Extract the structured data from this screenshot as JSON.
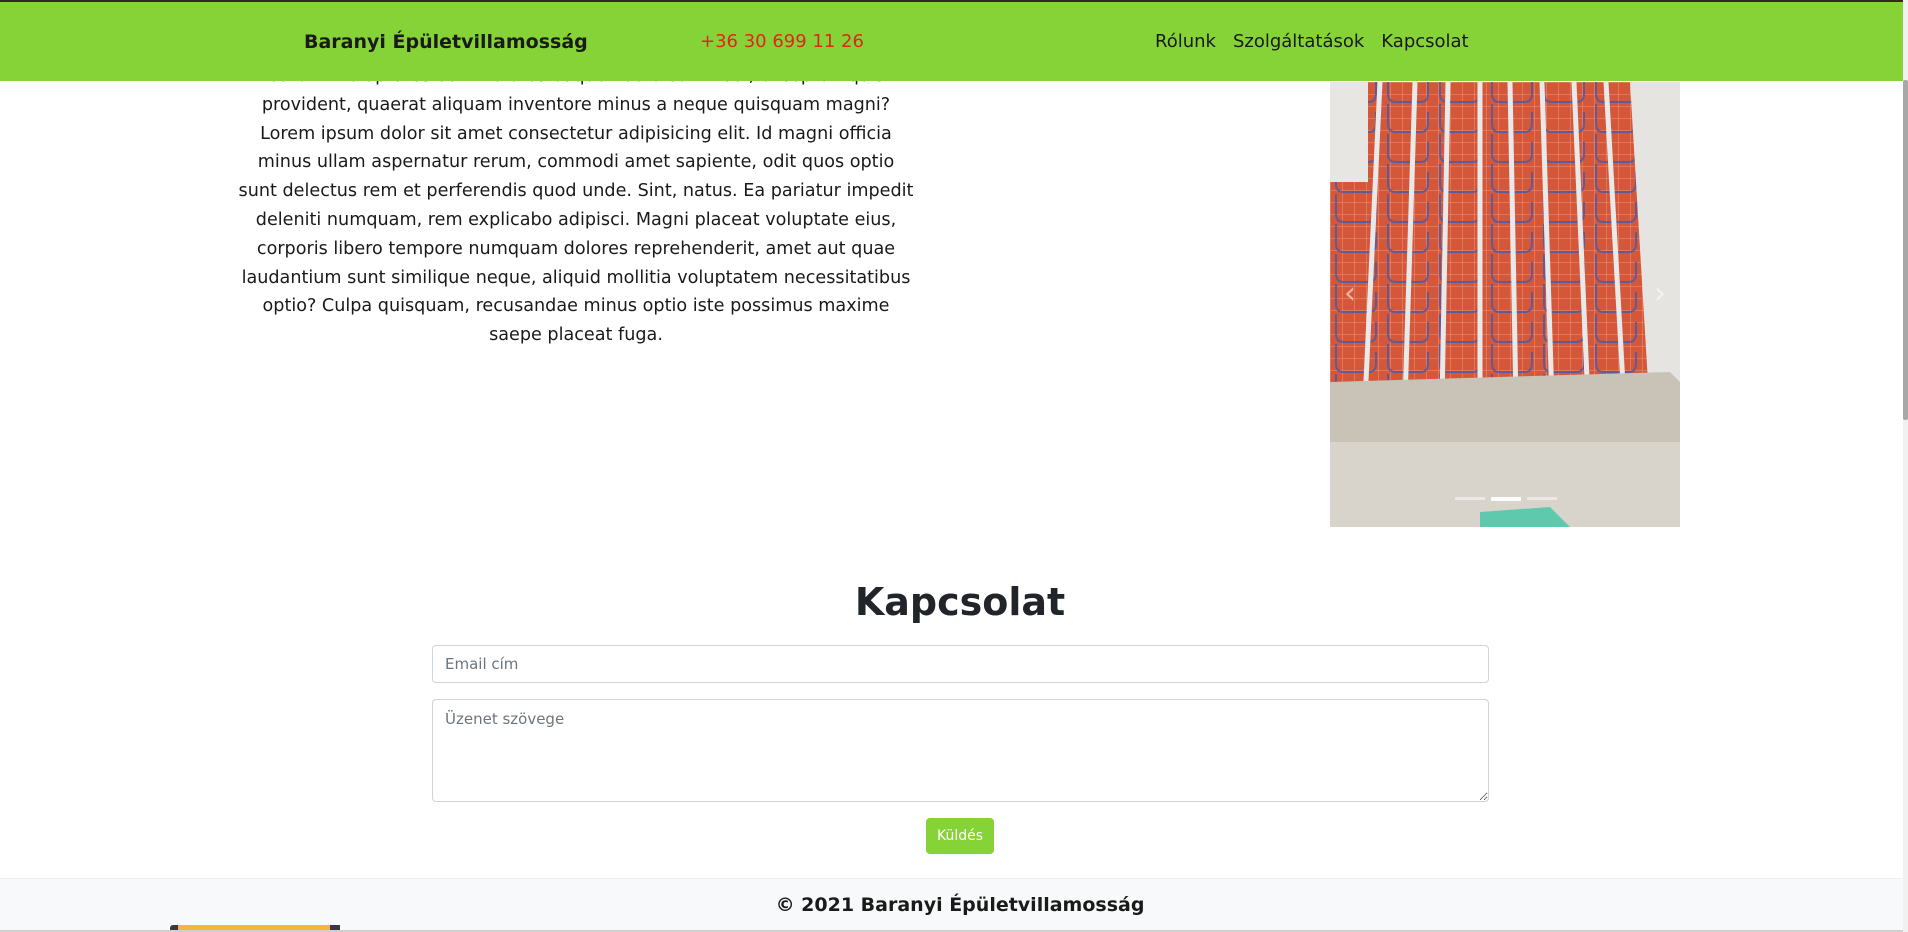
{
  "navbar": {
    "brand": "Baranyi Épületvillamosság",
    "phone": "+36 30 699 11 26",
    "links": [
      "Rólunk",
      "Szolgáltatások",
      "Kapcsolat"
    ]
  },
  "about": {
    "text": "earum! Voluptates odit maiores eaque libero commodi, excepturi quis provident, quaerat aliquam inventore minus a neque quisquam magni? Lorem ipsum dolor sit amet consectetur adipisicing elit. Id magni officia minus ullam aspernatur rerum, commodi amet sapiente, odit quos optio sunt delectus rem et perferendis quod unde. Sint, natus. Ea pariatur impedit deleniti numquam, rem explicabo adipisci. Magni placeat voluptate eius, corporis libero tempore numquam dolores reprehenderit, amet aut quae laudantium sunt similique neque, aliquid mollitia voluptatem necessitatibus optio? Culpa quisquam, recusandae minus optio iste possimus maxime saepe placeat fuga."
  },
  "carousel": {
    "prev_icon": "‹",
    "next_icon": "›",
    "slide_count": 3,
    "active_index": 1
  },
  "contact": {
    "title": "Kapcsolat",
    "email_placeholder": "Email cím",
    "message_placeholder": "Üzenet szövege",
    "send_label": "Küldés"
  },
  "footer": {
    "text": "© 2021 Baranyi Épületvillamosság"
  },
  "colors": {
    "accent": "#86d337",
    "phone": "#e0261b"
  }
}
